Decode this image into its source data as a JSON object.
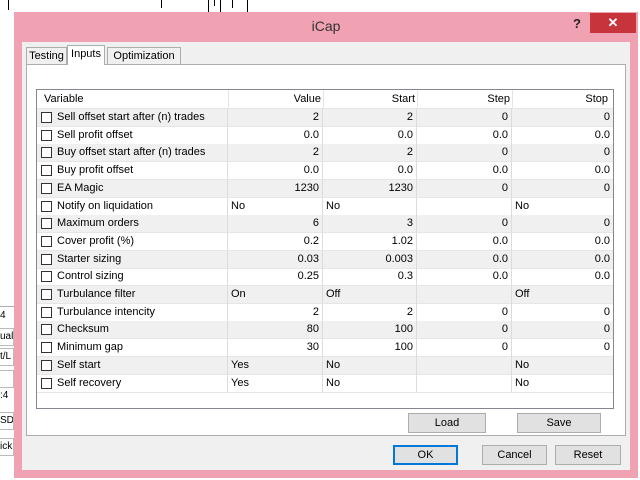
{
  "background": {
    "side_fragments": [
      "4",
      "ual",
      "t/L",
      "",
      ":4",
      "SD",
      "ick"
    ]
  },
  "dialog": {
    "title": "iCap",
    "help_label": "?",
    "close_label": "✕",
    "tabs": [
      {
        "label": "Testing",
        "active": false
      },
      {
        "label": "Inputs",
        "active": true
      },
      {
        "label": "Optimization",
        "active": false
      }
    ],
    "columns": {
      "variable": "Variable",
      "value": "Value",
      "start": "Start",
      "step": "Step",
      "stop": "Stop"
    },
    "rows": [
      {
        "variable": "Sell offset start after (n) trades",
        "value": "2",
        "start": "2",
        "step": "0",
        "stop": "0",
        "checked": false
      },
      {
        "variable": "Sell profit offset",
        "value": "0.0",
        "start": "0.0",
        "step": "0.0",
        "stop": "0.0",
        "checked": false
      },
      {
        "variable": "Buy offset start after (n) trades",
        "value": "2",
        "start": "2",
        "step": "0",
        "stop": "0",
        "checked": false
      },
      {
        "variable": "Buy profit offset",
        "value": "0.0",
        "start": "0.0",
        "step": "0.0",
        "stop": "0.0",
        "checked": false
      },
      {
        "variable": "EA Magic",
        "value": "1230",
        "start": "1230",
        "step": "0",
        "stop": "0",
        "checked": false
      },
      {
        "variable": "Notify on liquidation",
        "value": "No",
        "start": "No",
        "step": "",
        "stop": "No",
        "checked": false,
        "text": true
      },
      {
        "variable": "Maximum orders",
        "value": "6",
        "start": "3",
        "step": "0",
        "stop": "0",
        "checked": false
      },
      {
        "variable": "Cover profit (%)",
        "value": "0.2",
        "start": "1.02",
        "step": "0.0",
        "stop": "0.0",
        "checked": false
      },
      {
        "variable": "Starter sizing",
        "value": "0.03",
        "start": "0.003",
        "step": "0.0",
        "stop": "0.0",
        "checked": false
      },
      {
        "variable": "Control sizing",
        "value": "0.25",
        "start": "0.3",
        "step": "0.0",
        "stop": "0.0",
        "checked": false
      },
      {
        "variable": "Turbulance filter",
        "value": "On",
        "start": "Off",
        "step": "",
        "stop": "Off",
        "checked": false,
        "text": true
      },
      {
        "variable": "Turbulance intencity",
        "value": "2",
        "start": "2",
        "step": "0",
        "stop": "0",
        "checked": false
      },
      {
        "variable": "Checksum",
        "value": "80",
        "start": "100",
        "step": "0",
        "stop": "0",
        "checked": false
      },
      {
        "variable": "Minimum gap",
        "value": "30",
        "start": "100",
        "step": "0",
        "stop": "0",
        "checked": false
      },
      {
        "variable": "Self start",
        "value": "Yes",
        "start": "No",
        "step": "",
        "stop": "No",
        "checked": false,
        "text": true
      },
      {
        "variable": "Self recovery",
        "value": "Yes",
        "start": "No",
        "step": "",
        "stop": "No",
        "checked": false,
        "text": true
      }
    ],
    "buttons": {
      "load": "Load",
      "save": "Save",
      "ok": "OK",
      "cancel": "Cancel",
      "reset": "Reset"
    },
    "colors": {
      "title_bar": "#f0a1b2",
      "close": "#c7343b",
      "alt_row": "#f0f0f0"
    }
  }
}
